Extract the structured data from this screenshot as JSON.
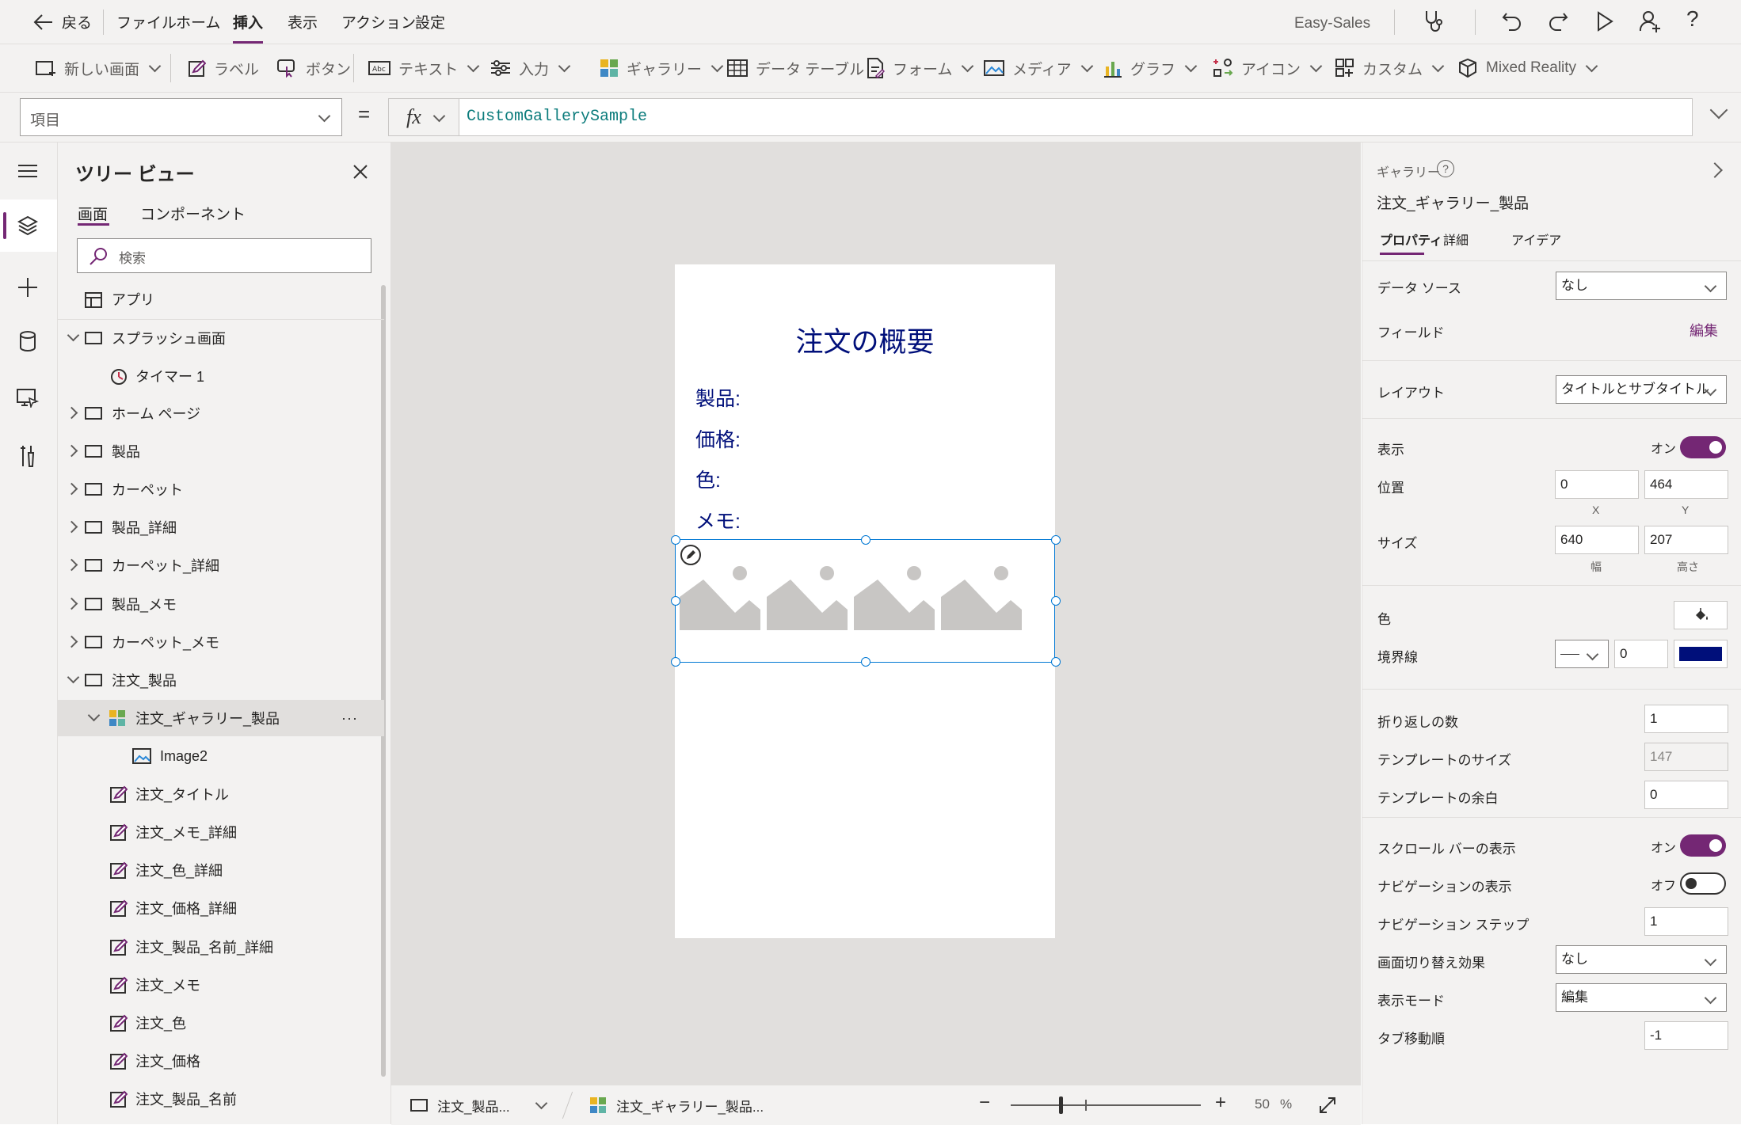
{
  "menubar": {
    "back_label": "戻る",
    "items": [
      "ファイル",
      "ホーム",
      "挿入",
      "表示",
      "アクション",
      "設定"
    ],
    "active_item": "挿入",
    "app_name": "Easy-Sales"
  },
  "ribbon": {
    "new_screen": "新しい画面",
    "label": "ラベル",
    "button": "ボタン",
    "text": "テキスト",
    "input": "入力",
    "gallery": "ギャラリー",
    "data_table": "データ テーブル",
    "form": "フォーム",
    "media": "メディア",
    "chart": "グラフ",
    "icon": "アイコン",
    "custom": "カスタム",
    "mixed_reality": "Mixed Reality"
  },
  "formula": {
    "property": "項目",
    "equals": "=",
    "fx": "fx",
    "value": "CustomGallerySample"
  },
  "tree": {
    "title": "ツリー ビュー",
    "tabs": [
      "画面",
      "コンポーネント"
    ],
    "search_placeholder": "検索",
    "items": [
      {
        "label": "アプリ",
        "type": "app",
        "level": 0
      },
      {
        "label": "スプラッシュ画面",
        "type": "screen",
        "level": 0,
        "expanded": true
      },
      {
        "label": "タイマー 1",
        "type": "timer",
        "level": 1
      },
      {
        "label": "ホーム ページ",
        "type": "screen",
        "level": 0,
        "expanded": false
      },
      {
        "label": "製品",
        "type": "screen",
        "level": 0,
        "expanded": false
      },
      {
        "label": "カーペット",
        "type": "screen",
        "level": 0,
        "expanded": false
      },
      {
        "label": "製品_詳細",
        "type": "screen",
        "level": 0,
        "expanded": false
      },
      {
        "label": "カーペット_詳細",
        "type": "screen",
        "level": 0,
        "expanded": false
      },
      {
        "label": "製品_メモ",
        "type": "screen",
        "level": 0,
        "expanded": false
      },
      {
        "label": "カーペット_メモ",
        "type": "screen",
        "level": 0,
        "expanded": false
      },
      {
        "label": "注文_製品",
        "type": "screen",
        "level": 0,
        "expanded": true
      },
      {
        "label": "注文_ギャラリー_製品",
        "type": "gallery",
        "level": 1,
        "expanded": true,
        "selected": true
      },
      {
        "label": "Image2",
        "type": "image",
        "level": 2
      },
      {
        "label": "注文_タイトル",
        "type": "label",
        "level": 1
      },
      {
        "label": "注文_メモ_詳細",
        "type": "label",
        "level": 1
      },
      {
        "label": "注文_色_詳細",
        "type": "label",
        "level": 1
      },
      {
        "label": "注文_価格_詳細",
        "type": "label",
        "level": 1
      },
      {
        "label": "注文_製品_名前_詳細",
        "type": "label",
        "level": 1
      },
      {
        "label": "注文_メモ",
        "type": "label",
        "level": 1
      },
      {
        "label": "注文_色",
        "type": "label",
        "level": 1
      },
      {
        "label": "注文_価格",
        "type": "label",
        "level": 1
      },
      {
        "label": "注文_製品_名前",
        "type": "label",
        "level": 1
      }
    ],
    "more": "···"
  },
  "canvas": {
    "title": "注文の概要",
    "labels": [
      "製品:",
      "価格:",
      "色:",
      "メモ:"
    ],
    "gallery_thumbnails": 4
  },
  "statusbar": {
    "screen": "注文_製品...",
    "control": "注文_ギャラリー_製品...",
    "zoom_value": "50",
    "zoom_unit": "%",
    "zoom_level": 0.5
  },
  "props": {
    "type": "ギャラリー",
    "name": "注文_ギャラリー_製品",
    "tabs": [
      "プロパティ",
      "詳細",
      "アイデア"
    ],
    "data_source_label": "データ ソース",
    "data_source_value": "なし",
    "fields_label": "フィールド",
    "fields_edit": "編集",
    "layout_label": "レイアウト",
    "layout_value": "タイトルとサブタイトル",
    "visible_label": "表示",
    "visible_value": "オン",
    "position_label": "位置",
    "x": "0",
    "y": "464",
    "x_label": "X",
    "y_label": "Y",
    "size_label": "サイズ",
    "width": "640",
    "height": "207",
    "width_label": "幅",
    "height_label": "高さ",
    "color_label": "色",
    "border_label": "境界線",
    "border_width": "0",
    "border_color": "#000f7a",
    "wrap_label": "折り返しの数",
    "wrap_value": "1",
    "template_size_label": "テンプレートのサイズ",
    "template_size_value": "147",
    "template_padding_label": "テンプレートの余白",
    "template_padding_value": "0",
    "scrollbar_label": "スクロール バーの表示",
    "scrollbar_value": "オン",
    "navigation_label": "ナビゲーションの表示",
    "navigation_value": "オフ",
    "nav_step_label": "ナビゲーション ステップ",
    "nav_step_value": "1",
    "transition_label": "画面切り替え効果",
    "transition_value": "なし",
    "display_mode_label": "表示モード",
    "display_mode_value": "編集",
    "tab_index_label": "タブ移動順",
    "tab_index_value": "-1"
  },
  "colors": {
    "accent": "#742774",
    "canvas_text": "#000f7a",
    "selection": "#0078d4"
  }
}
